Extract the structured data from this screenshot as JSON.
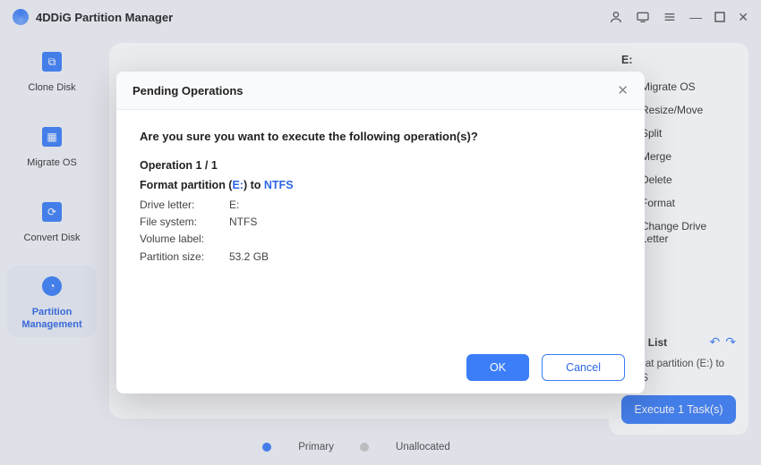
{
  "app": {
    "title": "4DDiG Partition Manager"
  },
  "sidebar": {
    "items": [
      {
        "label": "Clone Disk"
      },
      {
        "label": "Migrate OS"
      },
      {
        "label": "Convert Disk"
      },
      {
        "label": "Partition Management"
      }
    ]
  },
  "legend": {
    "primary": "Primary",
    "unallocated": "Unallocated"
  },
  "rightpanel": {
    "drive_header": "E:",
    "actions": [
      "Migrate OS",
      "Resize/Move",
      "Split",
      "Merge",
      "Delete",
      "Format",
      "Change Drive Letter"
    ],
    "task": {
      "header": "Task List",
      "body_line1": "Format partition (E:) to",
      "body_line2": "NTFS"
    },
    "execute_label": "Execute 1 Task(s)"
  },
  "modal": {
    "title": "Pending Operations",
    "confirm_question": "Are you sure you want to execute the following operation(s)?",
    "operation_header": "Operation  1 / 1",
    "format_line_prefix": "Format partition (",
    "format_drive": "E:",
    "format_line_mid": ") to ",
    "format_fs": "NTFS",
    "rows": {
      "drive_letter_k": "Drive letter:",
      "drive_letter_v": "E:",
      "fs_k": "File system:",
      "fs_v": "NTFS",
      "vol_k": "Volume label:",
      "vol_v": "",
      "size_k": "Partition size:",
      "size_v": "53.2 GB"
    },
    "ok_label": "OK",
    "cancel_label": "Cancel"
  }
}
